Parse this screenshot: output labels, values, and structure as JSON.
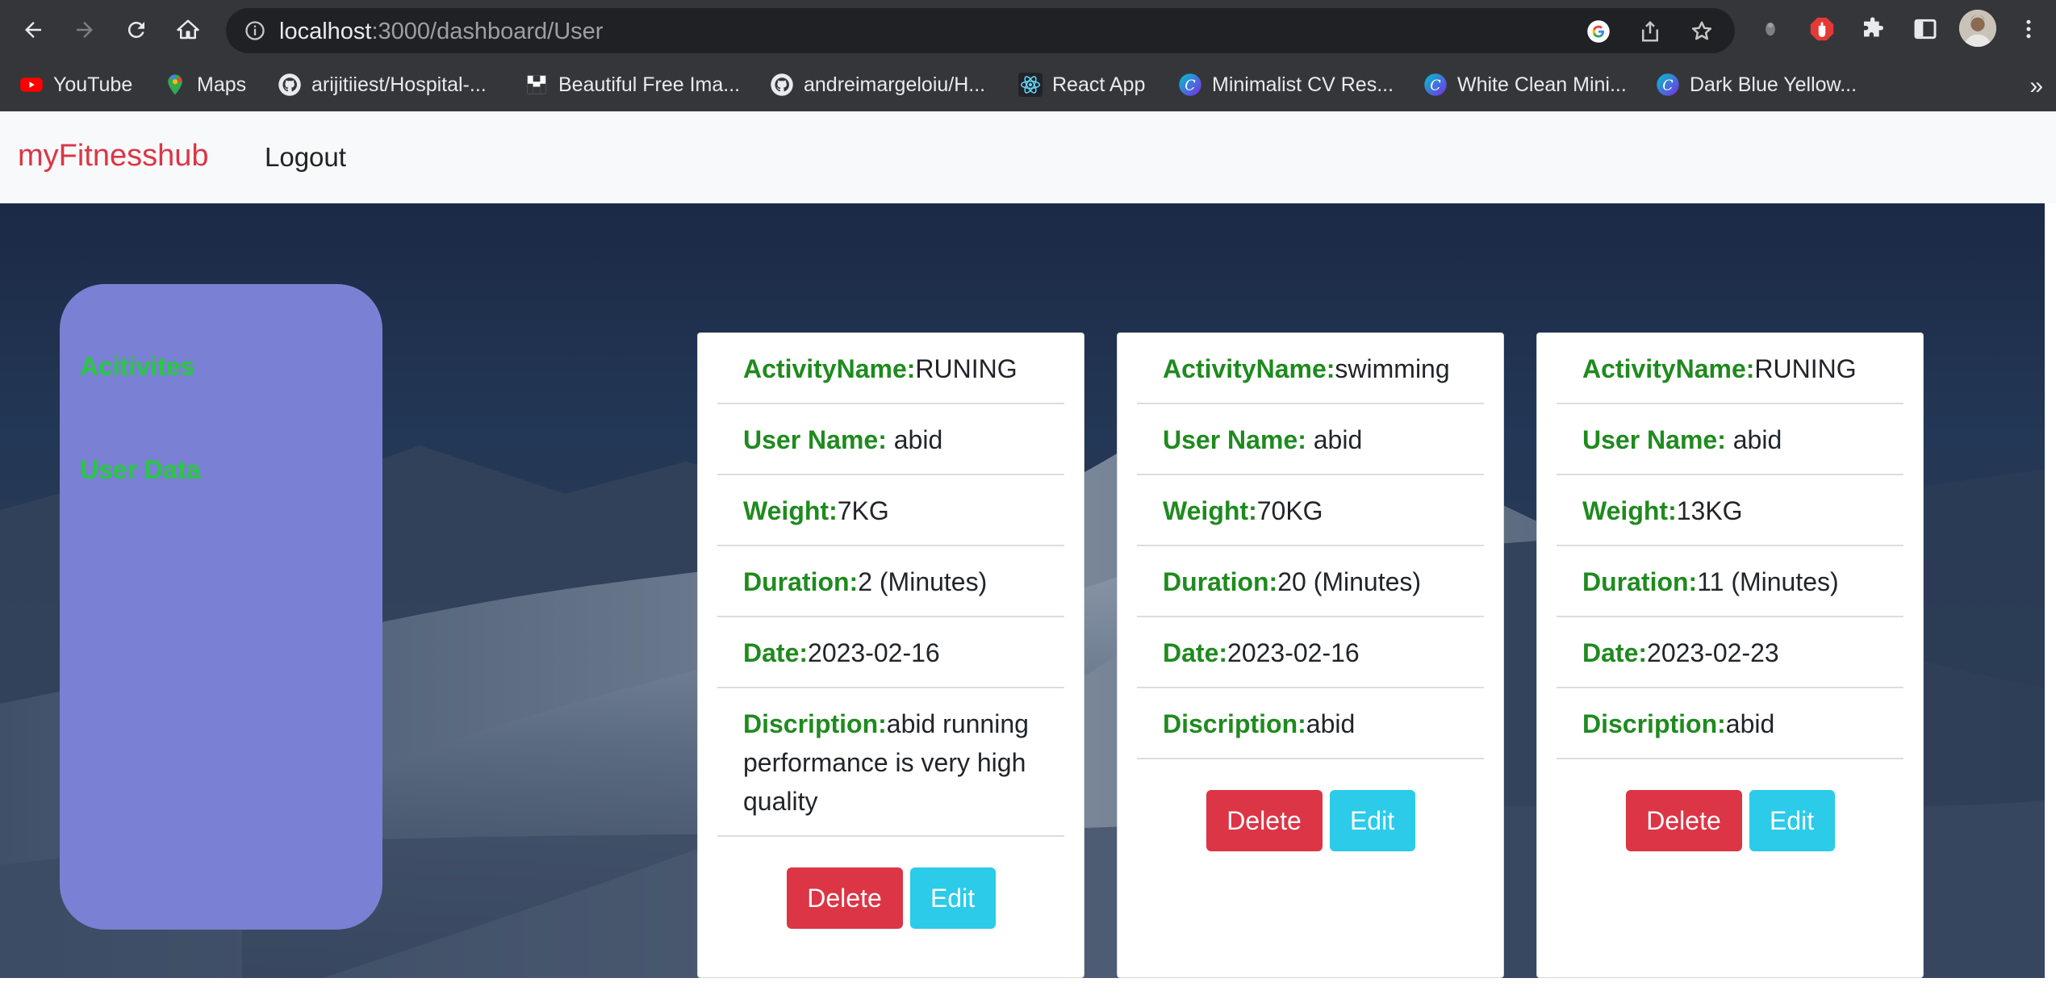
{
  "browser": {
    "url_host": "localhost",
    "url_path": ":3000/dashboard/User",
    "bookmarks": [
      {
        "label": "YouTube",
        "icon": "youtube-icon"
      },
      {
        "label": "Maps",
        "icon": "maps-icon"
      },
      {
        "label": "arijitiiest/Hospital-...",
        "icon": "github-icon"
      },
      {
        "label": "Beautiful Free Ima...",
        "icon": "unsplash-icon"
      },
      {
        "label": "andreimargeloiu/H...",
        "icon": "github-icon"
      },
      {
        "label": "React App",
        "icon": "react-icon"
      },
      {
        "label": "Minimalist CV Res...",
        "icon": "canva-icon"
      },
      {
        "label": "White Clean Mini...",
        "icon": "canva-icon"
      },
      {
        "label": "Dark Blue Yellow...",
        "icon": "canva-icon"
      }
    ],
    "more": "»"
  },
  "navbar": {
    "brand": "myFitnesshub",
    "logout": "Logout"
  },
  "sidebar": {
    "items": [
      "Acitivites",
      "User Data"
    ]
  },
  "labels": {
    "activity": "ActivityName:",
    "user": "User Name:",
    "weight": "Weight:",
    "duration": "Duration:",
    "date": "Date:",
    "description": "Discription:",
    "delete": "Delete",
    "edit": "Edit"
  },
  "activities": [
    {
      "activity": "RUNING",
      "user": " abid",
      "weight": "7KG",
      "duration": "2 (Minutes)",
      "date": "2023-02-16",
      "description": "abid running performance is very high quality"
    },
    {
      "activity": "swimming",
      "user": " abid",
      "weight": "70KG",
      "duration": "20 (Minutes)",
      "date": "2023-02-16",
      "description": "abid"
    },
    {
      "activity": "RUNING",
      "user": " abid",
      "weight": "13KG",
      "duration": "11 (Minutes)",
      "date": "2023-02-23",
      "description": "abid"
    }
  ],
  "colors": {
    "brand": "#dc3545",
    "sidebar_bg": "#7a80d3",
    "sidebar_link": "#28c940",
    "label_green": "#1f8a1f",
    "delete_btn": "#dc3545",
    "edit_btn": "#2bcbe9"
  }
}
